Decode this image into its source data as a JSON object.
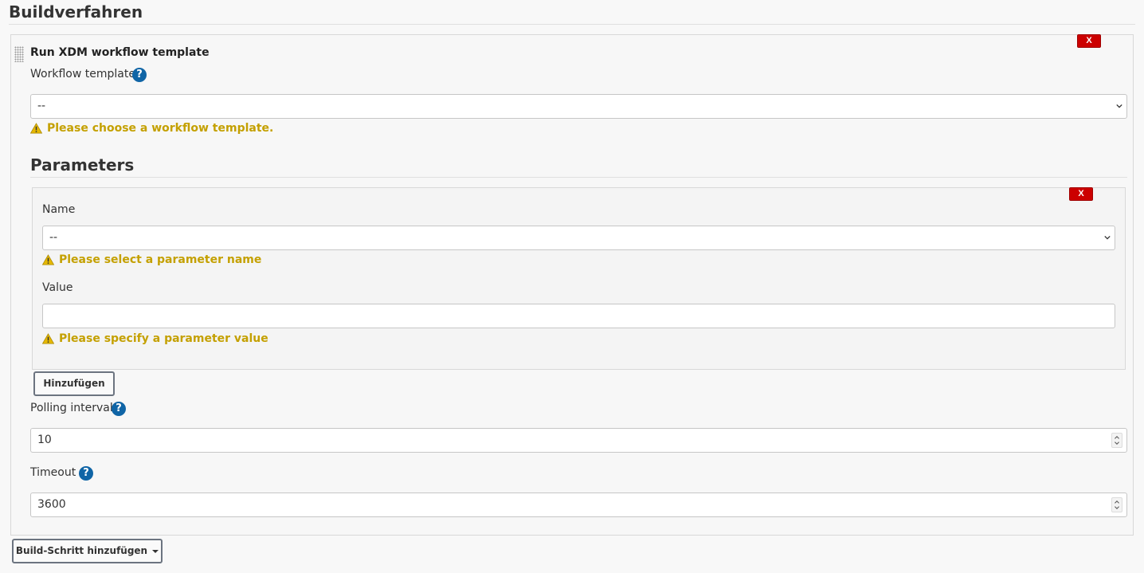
{
  "section": {
    "title": "Buildverfahren"
  },
  "step": {
    "title": "Run XDM workflow template",
    "delete_label": "X",
    "workflow_template": {
      "label": "Workflow template",
      "help": "?",
      "value": "--",
      "warning": "Please choose a workflow template."
    },
    "parameters": {
      "title": "Parameters",
      "delete_label": "X",
      "name": {
        "label": "Name",
        "value": "--",
        "warning": "Please select a parameter name"
      },
      "value": {
        "label": "Value",
        "value": "",
        "warning": "Please specify a parameter value"
      },
      "add_label": "Hinzufügen"
    },
    "polling_interval": {
      "label": "Polling interval",
      "help": "?",
      "value": "10"
    },
    "timeout": {
      "label": "Timeout",
      "help": "?",
      "value": "3600"
    }
  },
  "add_build_step_label": "Build-Schritt hinzufügen",
  "colors": {
    "delete": "#cc0000",
    "help": "#1065a6",
    "warning": "#c4a000"
  }
}
